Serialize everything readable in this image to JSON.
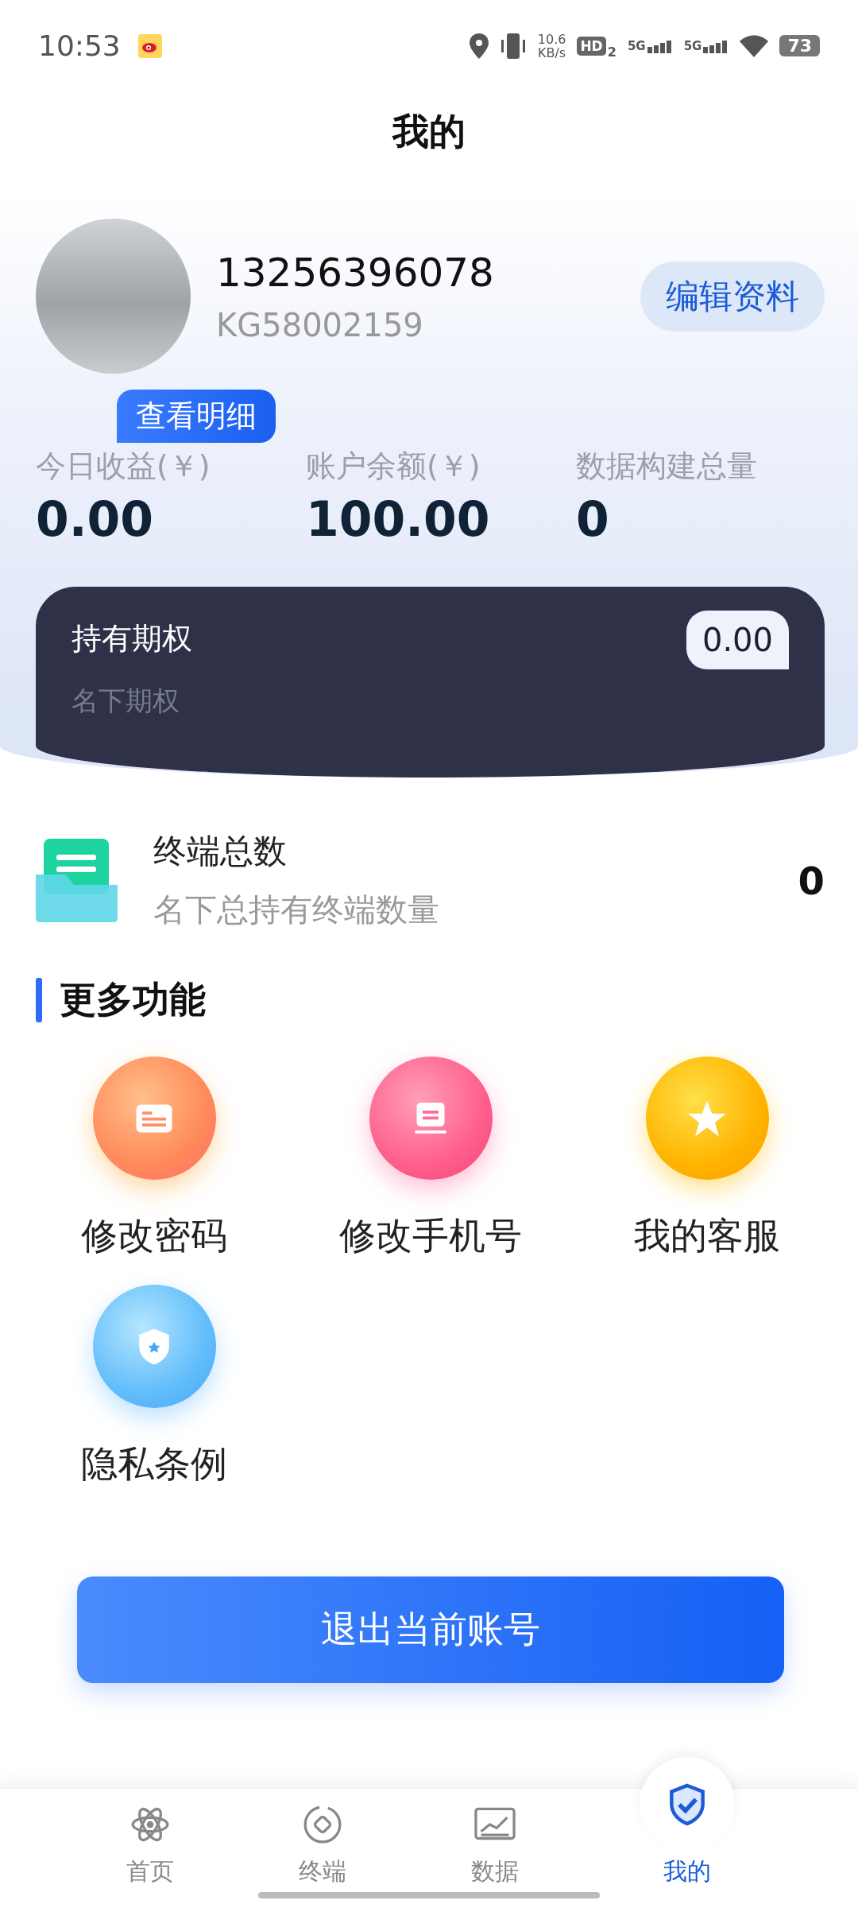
{
  "status_bar": {
    "time": "10:53",
    "net_speed": "10.6",
    "net_unit": "KB/s",
    "hd_label": "HD",
    "hd_sub": "2",
    "signals": [
      {
        "label": "5G"
      },
      {
        "label": "5G"
      }
    ],
    "battery": "73"
  },
  "title": "我的",
  "profile": {
    "phone": "13256396078",
    "id": "KG58002159",
    "edit_button": "编辑资料",
    "details_button": "查看明细"
  },
  "stats": [
    {
      "label": "今日收益(￥)",
      "value": "0.00"
    },
    {
      "label": "账户余额(￥)",
      "value": "100.00"
    },
    {
      "label": "数据构建总量",
      "value": "0"
    }
  ],
  "options_card": {
    "title": "持有期权",
    "subtitle": "名下期权",
    "value": "0.00"
  },
  "terminal": {
    "title": "终端总数",
    "subtitle": "名下总持有终端数量",
    "value": "0"
  },
  "more_section": {
    "heading": "更多功能",
    "items": [
      {
        "kind": "password",
        "label": "修改密码"
      },
      {
        "kind": "phone",
        "label": "修改手机号"
      },
      {
        "kind": "service",
        "label": "我的客服"
      },
      {
        "kind": "privacy",
        "label": "隐私条例"
      }
    ]
  },
  "logout_button": "退出当前账号",
  "nav": [
    {
      "kind": "home",
      "label": "首页",
      "selected": false
    },
    {
      "kind": "terminal",
      "label": "终端",
      "selected": false
    },
    {
      "kind": "data",
      "label": "数据",
      "selected": false
    },
    {
      "kind": "mine",
      "label": "我的",
      "selected": true
    }
  ]
}
